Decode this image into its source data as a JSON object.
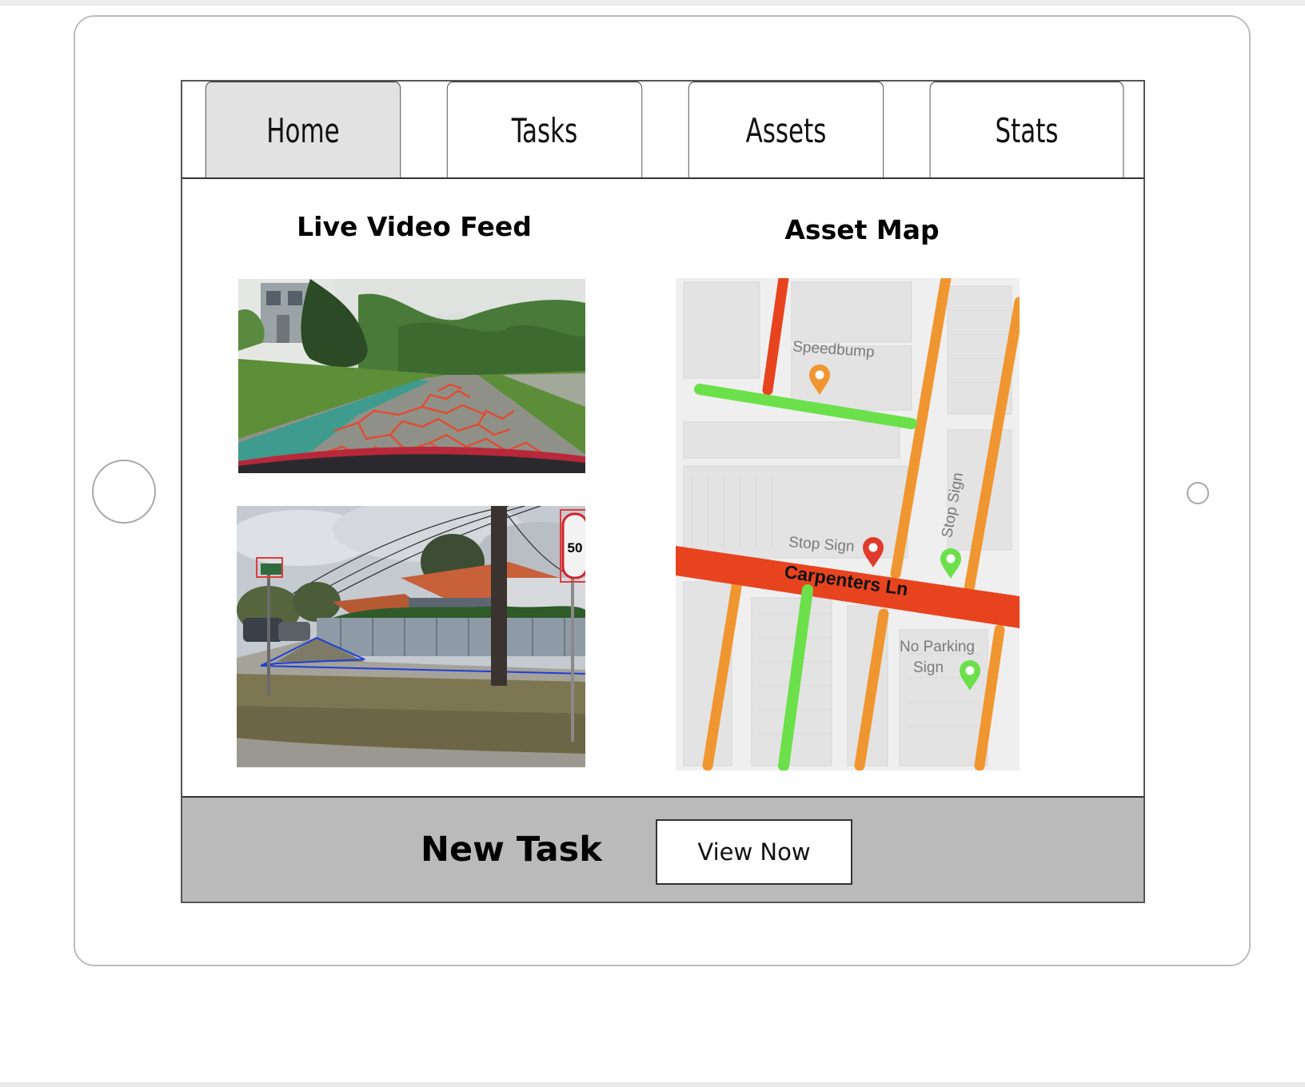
{
  "tabs": [
    {
      "label": "Home",
      "active": true
    },
    {
      "label": "Tasks",
      "active": false
    },
    {
      "label": "Assets",
      "active": false
    },
    {
      "label": "Stats",
      "active": false
    }
  ],
  "video_feed": {
    "title": "Live Video Feed",
    "frames": [
      {
        "description": "road surface crack detection overlay",
        "icon": "road-camera-image"
      },
      {
        "description": "street sign and footpath detection overlay",
        "icon": "street-camera-image"
      }
    ]
  },
  "asset_map": {
    "title": "Asset Map",
    "street_name": "Carpenters Ln",
    "markers": [
      {
        "label": "Speedbump",
        "color": "#f09630",
        "icon": "map-pin-icon"
      },
      {
        "label": "Stop Sign",
        "color": "#e03a2a",
        "icon": "map-pin-icon"
      },
      {
        "label": "Stop Sign",
        "color": "#6be04a",
        "icon": "map-pin-icon"
      },
      {
        "label": "No Parking Sign",
        "color": "#6be04a",
        "icon": "map-pin-icon"
      }
    ],
    "colors": {
      "red": "#e8431f",
      "orange": "#f09630",
      "green": "#6be04a"
    }
  },
  "sign_50": "50",
  "footer": {
    "label": "New Task",
    "button": "View Now"
  }
}
